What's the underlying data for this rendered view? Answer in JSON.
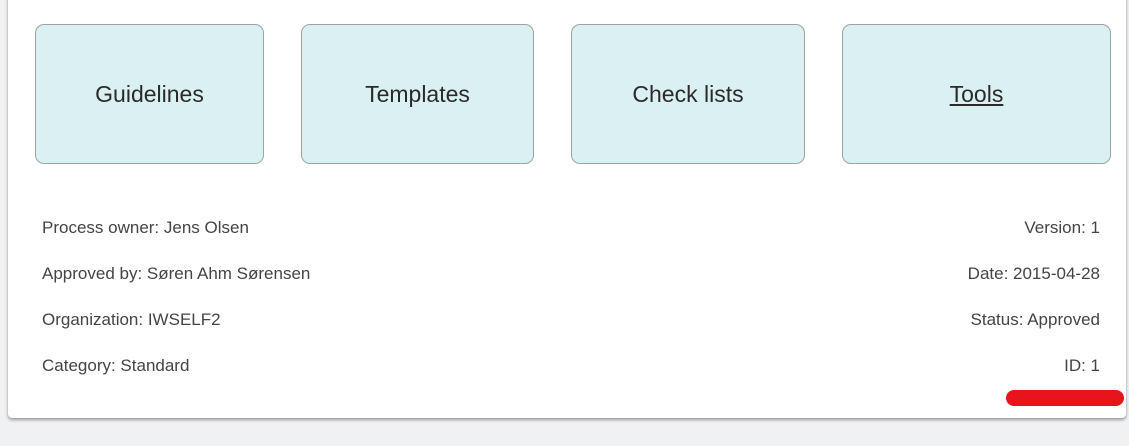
{
  "tiles": {
    "guidelines": "Guidelines",
    "templates": "Templates",
    "checklists": "Check lists",
    "tools": "Tools"
  },
  "info": {
    "process_owner": "Process owner: Jens Olsen",
    "approved_by": "Approved by: Søren Ahm Sørensen",
    "organization": "Organization: IWSELF2",
    "category": "Category: Standard",
    "version": "Version: 1",
    "date": "Date: 2015-04-28",
    "status": "Status: Approved",
    "id": "ID: 1"
  },
  "colors": {
    "tile_background": "#dbf1f1",
    "annotation_mark": "#e8141c"
  }
}
